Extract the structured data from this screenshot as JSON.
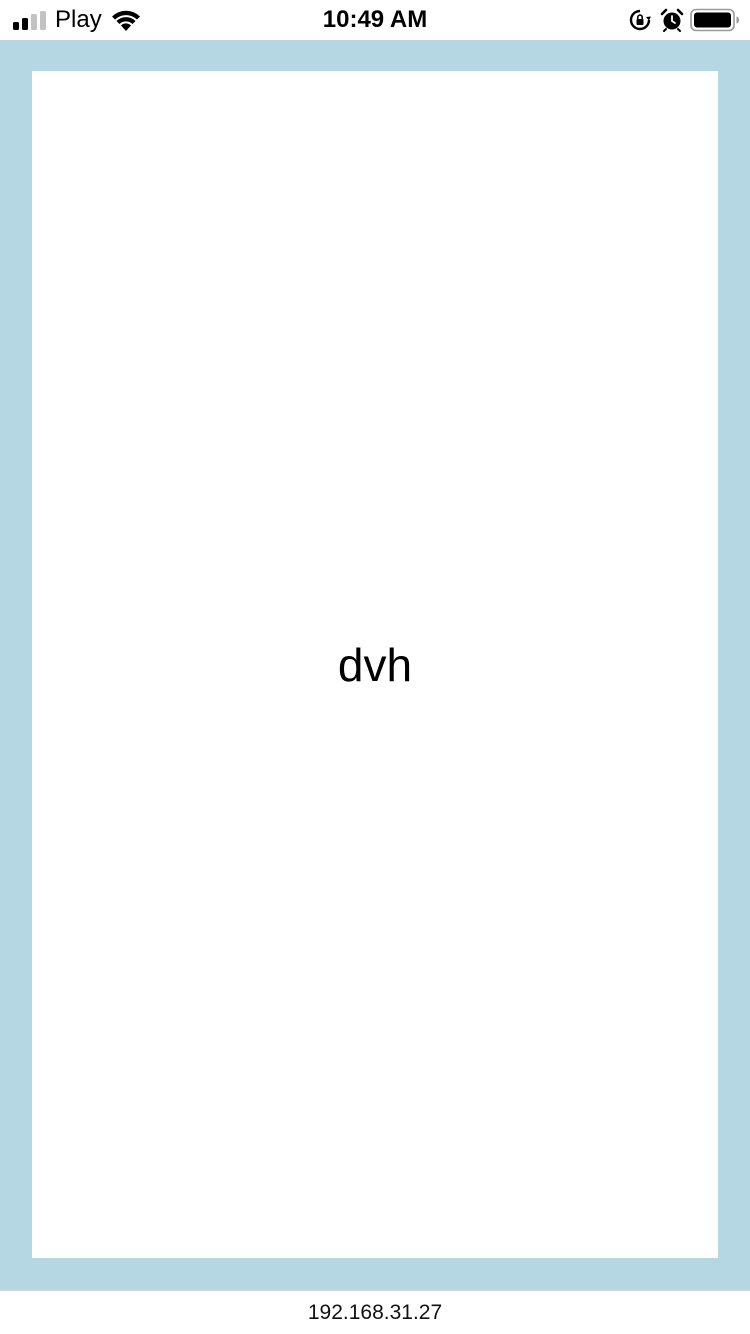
{
  "status_bar": {
    "carrier": "Play",
    "time": "10:49 AM",
    "icons": [
      "signal-icon",
      "wifi-icon",
      "rotation-lock-icon",
      "alarm-icon",
      "battery-icon"
    ]
  },
  "content": {
    "label": "dvh"
  },
  "bottom_bar": {
    "url": "192.168.31.27"
  },
  "colors": {
    "viewport_background": "#b5d7e3",
    "content_background": "#ffffff"
  }
}
